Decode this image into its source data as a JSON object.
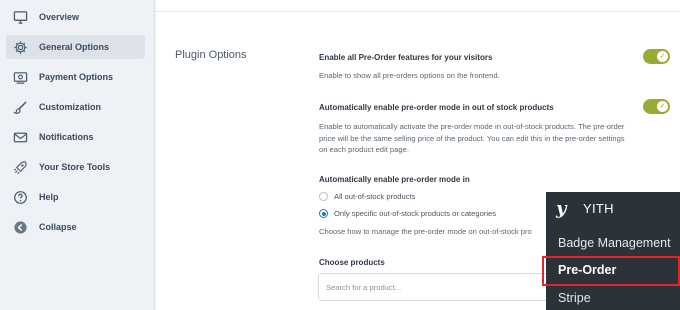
{
  "sidebar": {
    "items": [
      {
        "label": "Overview",
        "icon": "monitor-icon"
      },
      {
        "label": "General Options",
        "icon": "gear-icon"
      },
      {
        "label": "Payment Options",
        "icon": "payment-icon"
      },
      {
        "label": "Customization",
        "icon": "brush-icon"
      },
      {
        "label": "Notifications",
        "icon": "envelope-icon"
      },
      {
        "label": "Your Store Tools",
        "icon": "rocket-icon"
      },
      {
        "label": "Help",
        "icon": "help-icon"
      },
      {
        "label": "Collapse",
        "icon": "collapse-arrow-icon"
      }
    ],
    "active_index": 1
  },
  "main": {
    "section_title": "Plugin Options",
    "option1": {
      "title": "Enable all Pre-Order features for your visitors",
      "description": "Enable to show all pre-orders options on the frontend.",
      "enabled": true
    },
    "option2": {
      "title": "Automatically enable pre-order mode in out of stock products",
      "description": "Enable to automatically activate the pre-order mode in out-of-stock products. The pre-order price will be the same selling price of the product. You can edit this in the pre-order settings on each product edit page.",
      "enabled": true
    },
    "option3": {
      "title": "Automatically enable pre-order mode in",
      "choices": [
        "All out-of-stock products",
        "Only specific out-of-stock products or categories"
      ],
      "selected_index": 1,
      "description": "Choose how to manage the pre-order mode on out-of-stock pro"
    },
    "choose_products": {
      "title": "Choose products",
      "placeholder": "Search for a product..."
    }
  },
  "wp_menu": {
    "header": "YITH",
    "logo_letter": "y",
    "items": [
      "Badge Management",
      "Pre-Order",
      "Stripe"
    ],
    "current_index": 1
  },
  "colors": {
    "toggle_on": "#9aab34",
    "radio_selected": "#1f7fb8",
    "wp_menu_bg": "#2c3338",
    "highlight": "#e3242b"
  }
}
